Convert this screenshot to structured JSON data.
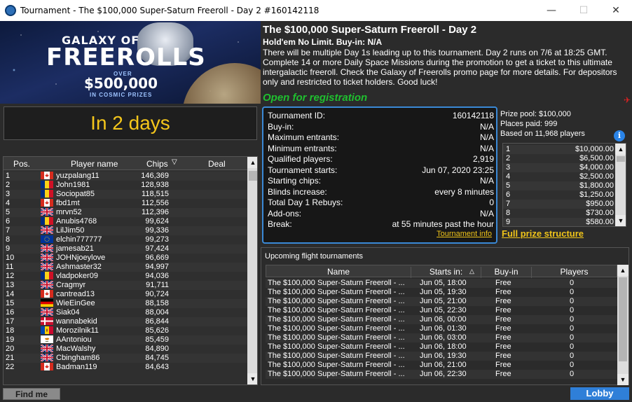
{
  "window": {
    "title": "Tournament - The $100,000 Super-Saturn Freeroll - Day 2 #160142118",
    "minimize": "—",
    "maximize": "☐",
    "close": "✕"
  },
  "banner": {
    "line1": "GALAXY OF",
    "line2": "FREEROLLS",
    "line3": "OVER",
    "line4": "$500,000",
    "line5": "IN COSMIC PRIZES"
  },
  "info": {
    "title": "The $100,000 Super-Saturn Freeroll - Day 2",
    "game": "Hold'em No Limit. Buy-in: N/A",
    "description": "There will be multiple Day 1s leading up to this tournament. Day 2 runs on 7/6 at 18:25 GMT. Complete 14 or more Daily Space Missions during the promotion to get a ticket to this ultimate intergalactic freeroll. Check the Galaxy of Freerolls promo page for more details. For depositors only and restricted to ticket holders. Good luck!",
    "status": "Open for registration"
  },
  "countdown": "In 2 days",
  "players": {
    "headers": {
      "pos": "Pos.",
      "name": "Player name",
      "chips": "Chips",
      "deal": "Deal"
    },
    "rows": [
      {
        "pos": "1",
        "name": "yuzpalang11",
        "chips": "146,369",
        "flag": "ca"
      },
      {
        "pos": "2",
        "name": "John1981",
        "chips": "128,938",
        "flag": "ro"
      },
      {
        "pos": "3",
        "name": "Sociopat85",
        "chips": "118,515",
        "flag": "ro"
      },
      {
        "pos": "4",
        "name": "fbd1mt",
        "chips": "112,556",
        "flag": "ca"
      },
      {
        "pos": "5",
        "name": "mrvn52",
        "chips": "112,396",
        "flag": "gb"
      },
      {
        "pos": "6",
        "name": "Anubis4768",
        "chips": "99,624",
        "flag": "ro"
      },
      {
        "pos": "7",
        "name": "LilJim50",
        "chips": "99,336",
        "flag": "gb"
      },
      {
        "pos": "8",
        "name": "elchin777777",
        "chips": "99,273",
        "flag": "eu"
      },
      {
        "pos": "9",
        "name": "jamesab21",
        "chips": "97,424",
        "flag": "gb"
      },
      {
        "pos": "10",
        "name": "JOHNjoeylove",
        "chips": "96,669",
        "flag": "gb"
      },
      {
        "pos": "11",
        "name": "Ashmaster32",
        "chips": "94,997",
        "flag": "gb"
      },
      {
        "pos": "12",
        "name": "vladpoker09",
        "chips": "94,036",
        "flag": "ro"
      },
      {
        "pos": "13",
        "name": "Cragmyr",
        "chips": "91,711",
        "flag": "gb"
      },
      {
        "pos": "14",
        "name": "cantread13",
        "chips": "90,724",
        "flag": "ca"
      },
      {
        "pos": "15",
        "name": "WieEinGee",
        "chips": "88,158",
        "flag": "de"
      },
      {
        "pos": "16",
        "name": "Siak04",
        "chips": "88,004",
        "flag": "gb"
      },
      {
        "pos": "17",
        "name": "wannabekid",
        "chips": "86,844",
        "flag": "dk"
      },
      {
        "pos": "18",
        "name": "Morozilnik11",
        "chips": "85,626",
        "flag": "md"
      },
      {
        "pos": "19",
        "name": "AAntoniou",
        "chips": "85,459",
        "flag": "cy"
      },
      {
        "pos": "20",
        "name": "MacWalshy",
        "chips": "84,890",
        "flag": "gb"
      },
      {
        "pos": "21",
        "name": "Cbingham86",
        "chips": "84,745",
        "flag": "gb"
      },
      {
        "pos": "22",
        "name": "Badman119",
        "chips": "84,643",
        "flag": "ca"
      }
    ]
  },
  "details": {
    "rows": [
      {
        "label": "Tournament ID:",
        "value": "160142118"
      },
      {
        "label": "Buy-in:",
        "value": "N/A"
      },
      {
        "label": "Maximum entrants:",
        "value": "N/A"
      },
      {
        "label": "Minimum entrants:",
        "value": "N/A"
      },
      {
        "label": "Qualified players:",
        "value": "2,919"
      },
      {
        "label": "Tournament starts:",
        "value": "Jun 07, 2020 23:25"
      },
      {
        "label": "Starting chips:",
        "value": "N/A"
      },
      {
        "label": "Blinds increase:",
        "value": "every 8 minutes"
      },
      {
        "label": "Total Day 1 Rebuys:",
        "value": "0"
      },
      {
        "label": "Add-ons:",
        "value": "N/A"
      },
      {
        "label": "Break:",
        "value": "at 55 minutes past the hour"
      }
    ],
    "link": "Tournament info"
  },
  "prize": {
    "pool": "Prize pool: $100,000",
    "places": "Places paid: 999",
    "based": "Based on 11,968 players",
    "info_icon": "i",
    "rows": [
      {
        "place": "1",
        "amount": "$10,000.00"
      },
      {
        "place": "2",
        "amount": "$6,500.00"
      },
      {
        "place": "3",
        "amount": "$4,000.00"
      },
      {
        "place": "4",
        "amount": "$2,500.00"
      },
      {
        "place": "5",
        "amount": "$1,800.00"
      },
      {
        "place": "6",
        "amount": "$1,250.00"
      },
      {
        "place": "7",
        "amount": "$950.00"
      },
      {
        "place": "8",
        "amount": "$730.00"
      },
      {
        "place": "9",
        "amount": "$580.00"
      }
    ],
    "full_link": "Full prize structure"
  },
  "flights": {
    "title": "Upcoming flight tournaments",
    "headers": {
      "name": "Name",
      "starts": "Starts in:",
      "buyin": "Buy-in",
      "players": "Players"
    },
    "rows": [
      {
        "name": "The $100,000 Super-Saturn Freeroll - ...",
        "starts": "Jun 05, 18:00",
        "buyin": "Free",
        "players": "0"
      },
      {
        "name": "The $100,000 Super-Saturn Freeroll - ...",
        "starts": "Jun 05, 19:30",
        "buyin": "Free",
        "players": "0"
      },
      {
        "name": "The $100,000 Super-Saturn Freeroll - ...",
        "starts": "Jun 05, 21:00",
        "buyin": "Free",
        "players": "0"
      },
      {
        "name": "The $100,000 Super-Saturn Freeroll - ...",
        "starts": "Jun 05, 22:30",
        "buyin": "Free",
        "players": "0"
      },
      {
        "name": "The $100,000 Super-Saturn Freeroll - ...",
        "starts": "Jun 06, 00:00",
        "buyin": "Free",
        "players": "0"
      },
      {
        "name": "The $100,000 Super-Saturn Freeroll - ...",
        "starts": "Jun 06, 01:30",
        "buyin": "Free",
        "players": "0"
      },
      {
        "name": "The $100,000 Super-Saturn Freeroll - ...",
        "starts": "Jun 06, 03:00",
        "buyin": "Free",
        "players": "0"
      },
      {
        "name": "The $100,000 Super-Saturn Freeroll - ...",
        "starts": "Jun 06, 18:00",
        "buyin": "Free",
        "players": "0"
      },
      {
        "name": "The $100,000 Super-Saturn Freeroll - ...",
        "starts": "Jun 06, 19:30",
        "buyin": "Free",
        "players": "0"
      },
      {
        "name": "The $100,000 Super-Saturn Freeroll - ...",
        "starts": "Jun 06, 21:00",
        "buyin": "Free",
        "players": "0"
      },
      {
        "name": "The $100,000 Super-Saturn Freeroll - ...",
        "starts": "Jun 06, 22:30",
        "buyin": "Free",
        "players": "0"
      }
    ]
  },
  "buttons": {
    "find_me": "Find me",
    "lobby": "Lobby"
  }
}
